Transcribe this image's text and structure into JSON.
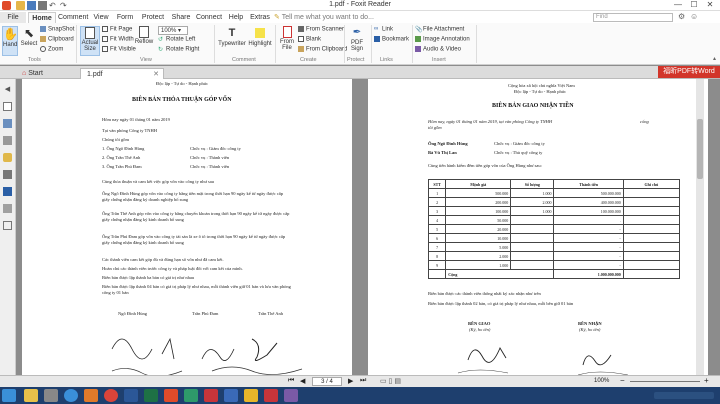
{
  "window": {
    "title": "1.pdf - Foxit Reader",
    "min": "—",
    "max": "☐",
    "close": "✕"
  },
  "menu": {
    "tabs": [
      "File",
      "Home",
      "Comment",
      "View",
      "Form",
      "Protect",
      "Share",
      "Connect",
      "Help",
      "Extras"
    ],
    "tell_me": "Tell me what you want to do...",
    "find_placeholder": "Find"
  },
  "ribbon": {
    "hand": "Hand",
    "select": "Select",
    "snapshot": "SnapShot",
    "clipboard": "Clipboard",
    "zoom": "Zoom",
    "actual_size": "Actual Size",
    "fit_page": "Fit Page",
    "fit_width": "Fit Width",
    "fit_visible": "Fit Visible",
    "reflow": "Reflow",
    "zoom_value": "100%",
    "rotate_left": "Rotate Left",
    "rotate_right": "Rotate Right",
    "typewriter": "Typewriter",
    "highlight": "Highlight",
    "from_file": "From File",
    "from_scanner": "From Scanner",
    "blank": "Blank",
    "from_clipboard": "From Clipboard",
    "pdf_sign": "PDF Sign",
    "link": "Link",
    "bookmark": "Bookmark",
    "file_attachment": "File Attachment",
    "image_annotation": "Image Annotation",
    "audio_video": "Audio & Video",
    "group_tools": "Tools",
    "group_view": "View",
    "group_comment": "Comment",
    "group_create": "Create",
    "group_protect": "Protect",
    "group_links": "Links",
    "group_insert": "Insert"
  },
  "doc_tabs": [
    "Start",
    "1.pdf"
  ],
  "stamp": "福昕PDF转Word",
  "page1": {
    "header": "Độc lập - Tự do - Hạnh phúc",
    "title": "BIÊN BẢN THỎA THUẬN GÓP VỐN",
    "date": "Hôm nay ngày 01 tháng 01 năm 2019",
    "office": "Tại văn phòng Công ty TNHH",
    "we": "Chúng tôi gồm",
    "m1": "1. Ông Ngô Đình Hùng",
    "r1": "Chức vụ : Giám đốc công ty",
    "m2": "2. Ông Trần Thế Anh",
    "r2": "Chức vụ : Thành viên",
    "m3": "3. Ông Trần Phú Đam",
    "r3": "Chức vụ : Thành viên",
    "agree": "Cùng thỏa thuận và cam kết việc góp vốn vào công ty như sau",
    "a1": "Ông Ngô Đình Hùng góp vốn vào công ty bằng tiền mặt trong thời hạn 90 ngày kể từ ngày được cấp",
    "a1b": "giấy chứng nhận đăng ký doanh nghiệp bổ sung",
    "a2": "Ông Trần Thế Anh góp vốn vào công ty bằng chuyển khoản trong thời hạn 90 ngày kể từ ngày được cấp",
    "a2b": "giấy chứng nhận đăng ký kinh doanh bổ sung",
    "a3": "Ông Trần Phú Đam góp vốn vào công ty tài sản là xe ô tô trong thời hạn 90 ngày kể từ ngày được cấp",
    "a3b": "giấy chứng nhận đăng ký kinh doanh bổ sung",
    "c1": "Các thành viên cam kết góp đủ và đúng hạn số vốn như đã cam kết.",
    "c2": "Hoàn chủ các thành viên trước công ty và pháp luật đối với cam kết của mình.",
    "c3": "Biên bản được lập thành ba bản có giá trị như nhau",
    "c4": "Biên bản được lập thành 04 bản có giá trị pháp lý như nhau, mỗi thành viên giữ 01 bản và lưu văn phòng",
    "c4b": "công ty 01 bản",
    "s1": "Ngô Đình Hùng",
    "s2": "Trần Phú Đam",
    "s3": "Trần Thế Anh"
  },
  "page2": {
    "h1": "Cộng hòa xã hội chủ nghĩa Việt Nam",
    "h2": "Độc lập - Tự do - Hạnh phúc",
    "title": "BIÊN BẢN GIAO NHẬN TIỀN",
    "date": "Hôm nay, ngày 01 tháng 01 năm 2019, tại văn phòng Công ty TNHH",
    "date_end": "cổng",
    "gom": "tôi gồm",
    "p1": "Ông Ngô Đình Hùng",
    "p1r": "Chức vụ : Giám đốc công ty",
    "p2": "Bà Vũ Thị Lan",
    "p2r": "Chức vụ : Thủ quỹ công ty",
    "intro": "Cùng tiến hành kiểm đếm tiền góp vốn của Ông Hùng như sau:",
    "headers": [
      "STT",
      "Mệnh giá",
      "Số lượng",
      "Thành tiền",
      "Ghi chú"
    ],
    "rows": [
      [
        "1",
        "500.000",
        "1.000",
        "500.000.000",
        ""
      ],
      [
        "2",
        "200.000",
        "2.000",
        "400.000.000",
        ""
      ],
      [
        "3",
        "100.000",
        "1.000",
        "100.000.000",
        ""
      ],
      [
        "4",
        "50.000",
        "",
        ".",
        ""
      ],
      [
        "5",
        "20.000",
        "",
        "-",
        ""
      ],
      [
        "6",
        "10.000",
        "",
        "-",
        ""
      ],
      [
        "7",
        "5.000",
        "",
        "-",
        ""
      ],
      [
        "8",
        "2.000",
        "",
        "-",
        ""
      ],
      [
        "9",
        "1.000",
        "",
        "-",
        ""
      ]
    ],
    "total_label": "Cộng",
    "total": "1.000.000.000",
    "foot1": "Biên bản được các thành viên thống nhất ký xác nhận như trên",
    "foot2": "Biên bản được lập thành 02 bản, có giá trị pháp lý như nhau, mỗi bên giữ 01 bản",
    "g": "BÊN GIAO",
    "gs": "(Ký, ho tên)",
    "n": "BÊN NHẬN",
    "ns": "(Ký, ho tên)"
  },
  "status": {
    "page": "3 / 4",
    "zoom": "100%"
  }
}
